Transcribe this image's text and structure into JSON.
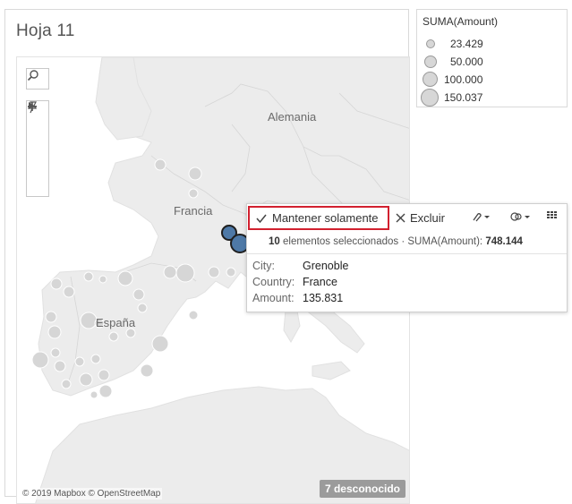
{
  "sheet": {
    "title": "Hoja 11"
  },
  "map": {
    "labels": {
      "germany": "Alemania",
      "france": "Francia",
      "spain": "España"
    },
    "attribution": "© 2019 Mapbox © OpenStreetMap",
    "unknown_badge": "7 desconocido",
    "controls": {
      "search_icon": "search-icon",
      "zoom_in_icon": "plus-icon",
      "zoom_out_icon": "minus-icon",
      "pin_icon": "pin-icon",
      "expand_icon": "play-arrow-icon"
    },
    "colors": {
      "mark": "#d6d6d6",
      "selected_mark": "#4e79a7",
      "land": "#ececec"
    }
  },
  "legend": {
    "title": "SUMA(Amount)",
    "items": [
      {
        "label": "23.429",
        "value": 23429
      },
      {
        "label": "50.000",
        "value": 50000
      },
      {
        "label": "100.000",
        "value": 100000
      },
      {
        "label": "150.037",
        "value": 150037
      }
    ]
  },
  "tooltip": {
    "keep_only_label": "Mantener solamente",
    "keep_only_icon": "check-icon",
    "exclude_label": "Excluir",
    "exclude_icon": "close-icon",
    "icons": [
      "paperclip-icon",
      "group-icon",
      "table-icon"
    ],
    "selected_count": "10",
    "selected_text": "elementos seleccionados",
    "separator": "·",
    "sum_label": "SUMA(Amount):",
    "sum_value": "748.144",
    "fields": [
      {
        "name": "City:",
        "value": "Grenoble"
      },
      {
        "name": "Country:",
        "value": "France"
      },
      {
        "name": "Amount:",
        "value": "135.831"
      }
    ],
    "accent_color": "#d2202f"
  }
}
